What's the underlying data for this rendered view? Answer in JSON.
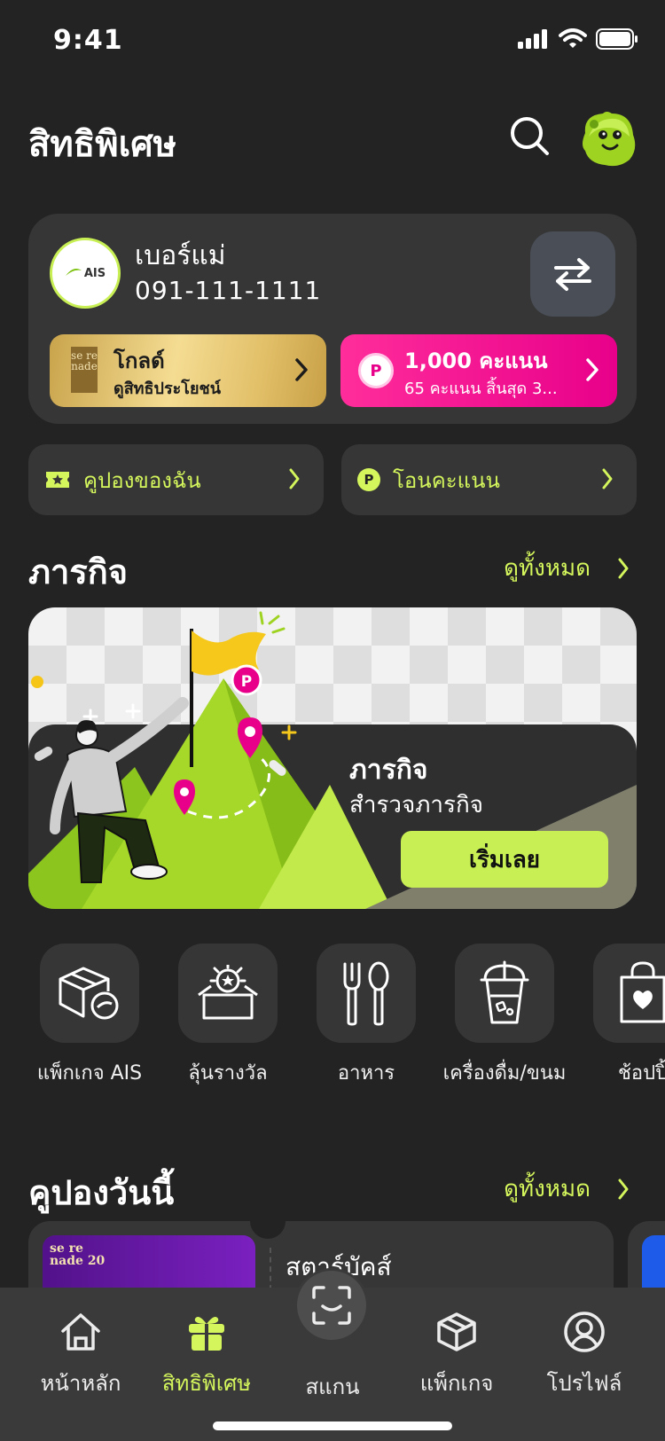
{
  "status": {
    "time": "9:41"
  },
  "header": {
    "title": "สิทธิพิเศษ"
  },
  "account": {
    "logo_text": "AIS",
    "name": "เบอร์แม่",
    "number": "091-111-1111",
    "tier": {
      "logo_text": "se re nade",
      "title": "โกลด์",
      "subtitle": "ดูสิทธิประโยชน์"
    },
    "points": {
      "coin": "P",
      "title": "1,000 คะแนน",
      "subtitle": "65 คะแนน สิ้นสุด 3..."
    }
  },
  "quick_actions": {
    "coupons": "คูปองของฉัน",
    "transfer": "โอนคะแนน",
    "transfer_icon": "P"
  },
  "missions": {
    "section_title": "ภารกิจ",
    "see_all": "ดูทั้งหมด",
    "banner": {
      "coin": "P",
      "title": "ภารกิจ",
      "subtitle": "สำรวจภารกิจ",
      "button": "เริ่มเลย"
    }
  },
  "categories": [
    {
      "label": "แพ็กเกจ AIS",
      "icon": "package-icon"
    },
    {
      "label": "ลุ้นรางวัล",
      "icon": "prize-box-icon"
    },
    {
      "label": "อาหาร",
      "icon": "fork-spoon-icon"
    },
    {
      "label": "เครื่องดื่ม/ขนม",
      "icon": "drink-cup-icon"
    },
    {
      "label": "ช้อปปิ้",
      "icon": "shopping-bag-icon"
    }
  ],
  "coupons_today": {
    "section_title": "คูปองวันนี้",
    "see_all": "ดูทั้งหมด",
    "first": {
      "title": "สตาร์บัคส์",
      "image_text": "se re nade 20"
    }
  },
  "tabbar": {
    "home": "หน้าหลัก",
    "privileges": "สิทธิพิเศษ",
    "scan": "สแกน",
    "packages": "แพ็กเกจ",
    "profile": "โปรไฟล์"
  },
  "colors": {
    "accent": "#d4f65c",
    "lime": "#c8f054",
    "pink": "#e8008a",
    "background": "#232323",
    "card": "#363636"
  }
}
